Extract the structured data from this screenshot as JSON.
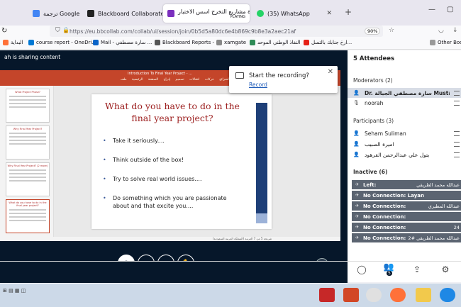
{
  "browser": {
    "tabs": [
      {
        "title": "ترجمة Google",
        "color": "#ffffff"
      },
      {
        "title": "Blackboard Collaborate Ultra -",
        "color": "#222222"
      },
      {
        "title": "دورة مشاريع التخرج اسس الاختبار",
        "subtitle": "PLAYING",
        "color": "#7b2fbe",
        "active": true
      },
      {
        "title": "(35) WhatsApp",
        "color": "#25d366"
      }
    ],
    "url": "https://eu.bbcollab.com/collab/ui/session/join/0b5d5a80dc6e4b869c9b8e3a2aec21af",
    "zoom": "90%",
    "bookmarks": [
      "البداية",
      "course report - OneDri...",
      "Mail - سارة مصطفي ...",
      "Blackboard Reports - ...",
      "xamgate",
      "النفاذ الوطني الموحد",
      "ارخ جنابك بالتسل...",
      "Other Bookm"
    ]
  },
  "app": {
    "sharing_label": "ah is sharing content",
    "ppt": {
      "title": "Introduction To Final Year Project - ...",
      "ribbon_tabs": [
        "ملف",
        "الصفحة الرئيسية",
        "إدراج",
        "تصميم",
        "انتقالات",
        "حركات",
        "عرض الشرائح",
        "مراجعة",
        "عرض"
      ],
      "thumbs": [
        "What Project Phase?",
        "Why Final Year Project?",
        "Why Final Year Project? (2 more)",
        "What do you have to do in the final year project?"
      ],
      "status": "شريحة 5 من 7  العربية (المملكة العربية السعودية)"
    },
    "slide": {
      "title": "What do you have to do in the final year project?",
      "bullets": [
        "Take it seriously....",
        "Think outside of the box!",
        "Try to solve real world issues....",
        "Do something which you are passionate about and that excite you...."
      ]
    },
    "presenter": "noorah",
    "record": {
      "title": "Start the recording?",
      "link": "Record"
    }
  },
  "panel": {
    "attendees": "5 Attendees",
    "moderators_label": "Moderators (2)",
    "moderators": [
      "Dr. سارة مصطفي الجبالة Mustafa بابكر",
      "noorah"
    ],
    "participants_label": "Participants (3)",
    "participants": [
      "Seham Suliman",
      "اميرة الصبيب",
      "بتول علي عبدالرحمن الفرهود"
    ],
    "inactive_label": "Inactive (6)",
    "inactive": [
      {
        "status": "Left:",
        "name": "عبدالله محمد الطريقي"
      },
      {
        "status": "No Connection:",
        "name": "Layan"
      },
      {
        "status": "No Connection:",
        "name": "عبدالله المطيري"
      },
      {
        "status": "No Connection:",
        "name": ""
      },
      {
        "status": "No Connection:",
        "name": "24"
      },
      {
        "status": "No Connection:",
        "name": "عبدالله محمد الطريقي #2"
      }
    ],
    "badge": "5"
  }
}
